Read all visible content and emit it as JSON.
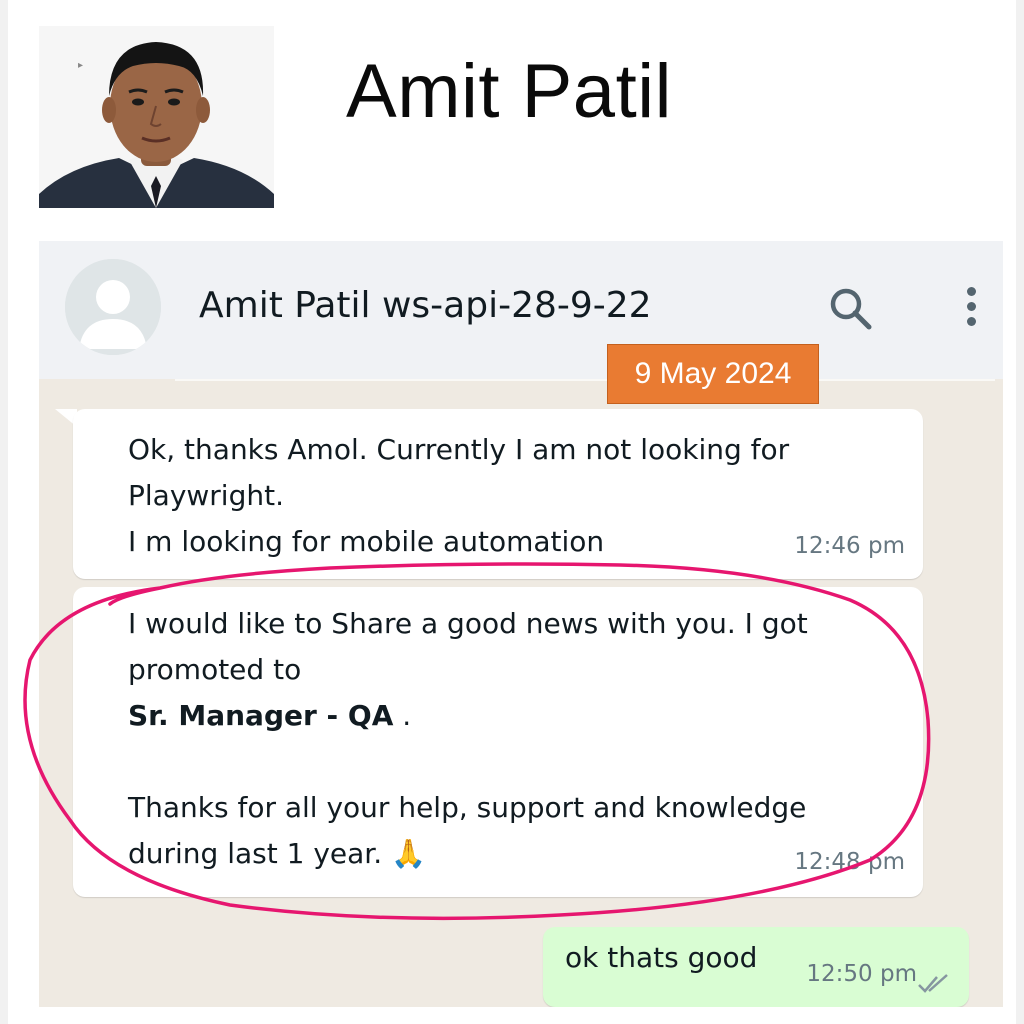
{
  "profile": {
    "name": "Amit Patil"
  },
  "chat": {
    "contact_name": "Amit Patil ws-api-28-9-22",
    "date_label": "9 May 2024",
    "messages": [
      {
        "direction": "incoming",
        "lines": [
          "Ok, thanks Amol. Currently I am not looking for",
          "Playwright.",
          "I m looking for mobile automation"
        ],
        "time": "12:46 pm"
      },
      {
        "direction": "incoming",
        "lines": [
          "I would like to Share a good news with you. I got",
          "promoted to"
        ],
        "bold": "Sr. Manager - QA",
        "bold_suffix": " .",
        "lines_after": [
          "Thanks for all your help, support and knowledge",
          "during last 1 year. 🙏"
        ],
        "time": "12:48 pm"
      },
      {
        "direction": "outgoing",
        "text": "ok thats good",
        "time": "12:50 pm",
        "status": "read"
      }
    ]
  },
  "colors": {
    "chat_background": "#efeae2",
    "header_background": "#f0f2f5",
    "outgoing_bubble": "#d9fdd3",
    "date_chip": "#e97b32",
    "highlight_circle": "#e6166f"
  },
  "icons": {
    "search": "search-icon",
    "menu": "kebab-menu-icon",
    "avatar": "default-avatar-icon",
    "ticks": "double-check-icon",
    "emoji": "folded-hands-emoji"
  }
}
